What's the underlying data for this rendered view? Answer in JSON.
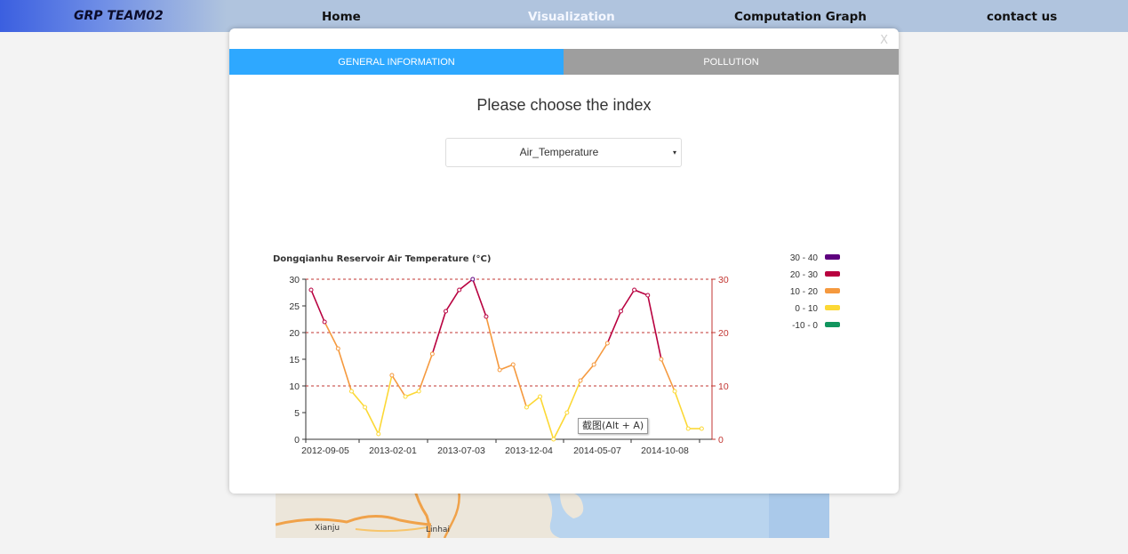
{
  "nav": {
    "brand": "GRP TEAM02",
    "items": [
      {
        "label": "Home",
        "name": "nav-home"
      },
      {
        "label": "Visualization",
        "name": "nav-visualization",
        "active": true
      },
      {
        "label": "Computation Graph",
        "name": "nav-computation-graph"
      },
      {
        "label": "contact us",
        "name": "nav-contact-us"
      }
    ]
  },
  "map": {
    "labels": [
      "Xianju",
      "Linhai"
    ]
  },
  "modal": {
    "close_label": "X",
    "tabs": [
      {
        "label": "GENERAL INFORMATION",
        "active": true
      },
      {
        "label": "POLLUTION",
        "active": false
      }
    ],
    "prompt": "Please choose the index",
    "select": {
      "value": "Air_Temperature",
      "caret": "▾"
    }
  },
  "tooltip": "截图(Alt + A)",
  "colors": {
    "nav_bg": "#b0c4de",
    "tab_active": "#2ea8ff",
    "tab_inactive": "#9e9e9e",
    "axis_right": "#c23531"
  },
  "chart_data": {
    "type": "line",
    "title": "Dongqianhu Reservoir Air Temperature (°C)",
    "x_tick_labels": [
      "2012-09-05",
      "2013-02-01",
      "2013-07-03",
      "2013-12-04",
      "2014-05-07",
      "2014-10-08"
    ],
    "ylim": [
      0,
      30
    ],
    "y_ticks": [
      0,
      5,
      10,
      15,
      20,
      25,
      30
    ],
    "y2_ticks": [
      0,
      10,
      20,
      30
    ],
    "markline_values": [
      10,
      20,
      30
    ],
    "values": [
      28,
      22,
      17,
      9,
      6,
      1,
      12,
      8,
      9,
      16,
      24,
      28,
      30,
      23,
      13,
      14,
      6,
      8,
      0,
      5,
      11,
      14,
      18,
      24,
      28,
      27,
      15,
      9,
      2,
      2
    ],
    "grid": false,
    "legend_position": "top-right",
    "visual_map": [
      {
        "label": "30 - 40",
        "min": 30,
        "max": 40,
        "color": "#5e007e"
      },
      {
        "label": "20 - 30",
        "min": 20,
        "max": 30,
        "color": "#b8003f"
      },
      {
        "label": "10 - 20",
        "min": 10,
        "max": 20,
        "color": "#f5993e"
      },
      {
        "label": "0 - 10",
        "min": 0,
        "max": 10,
        "color": "#fcd835"
      },
      {
        "label": "-10 - 0",
        "min": -10,
        "max": 0,
        "color": "#11955e"
      }
    ]
  }
}
